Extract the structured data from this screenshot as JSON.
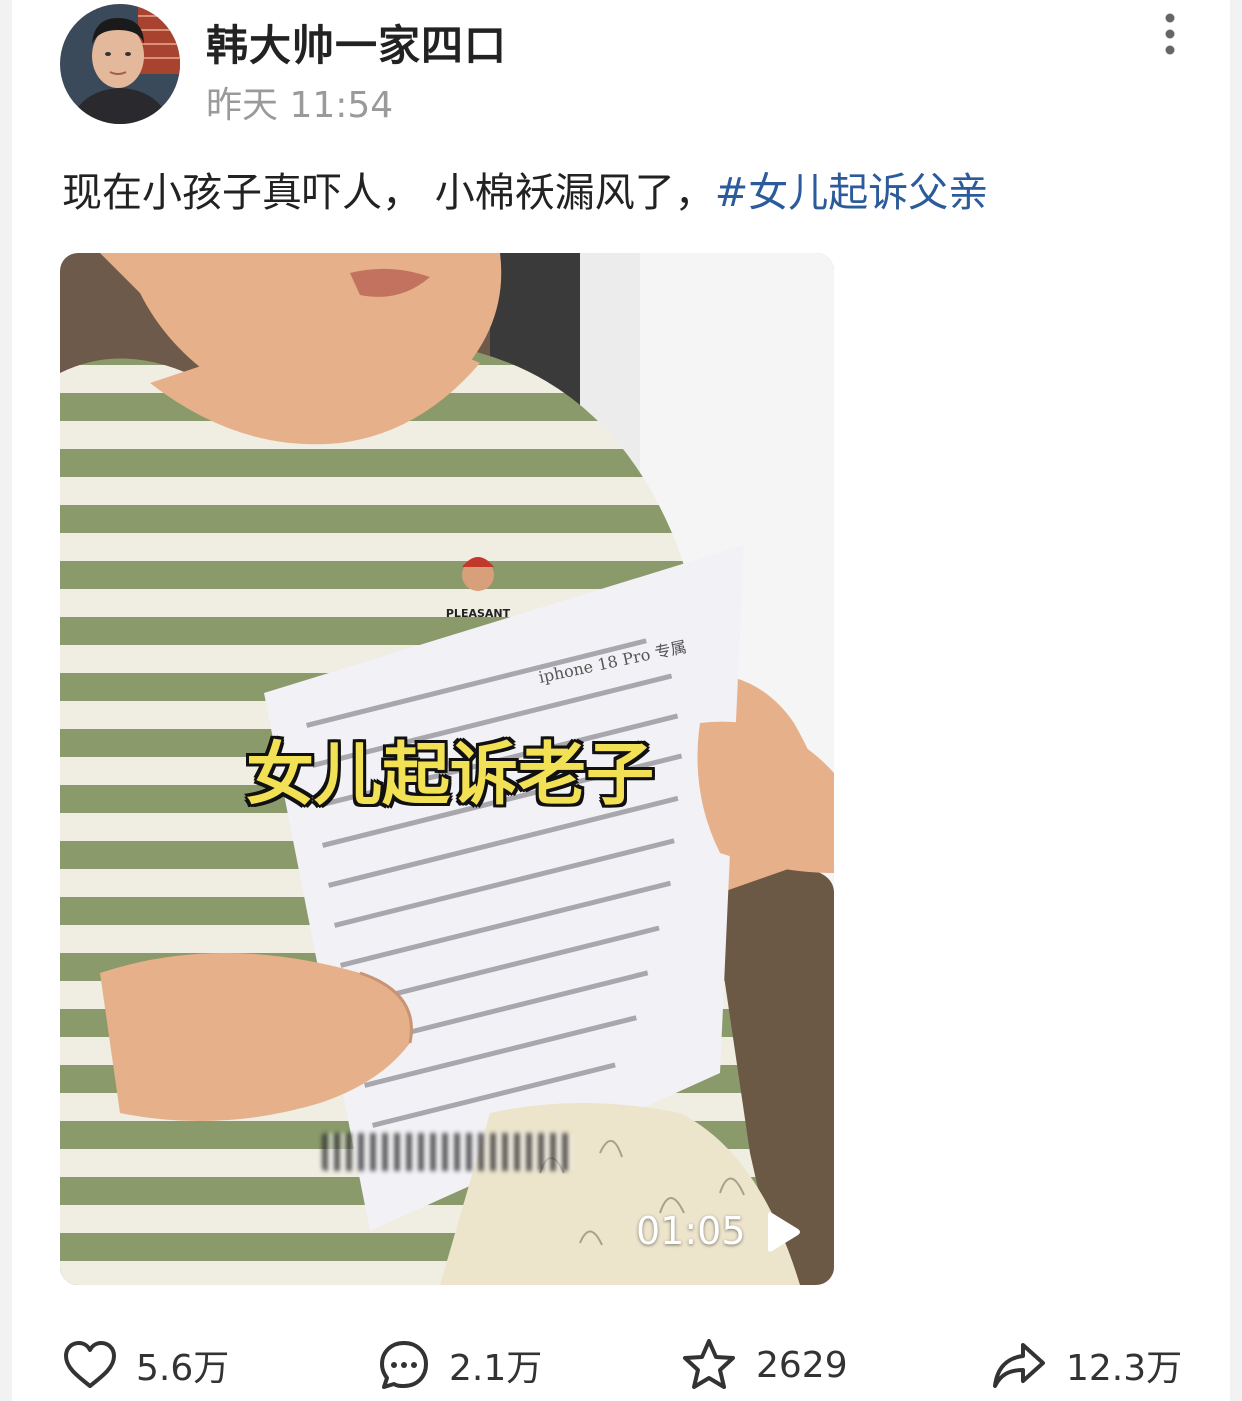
{
  "post": {
    "author": "韩大帅一家四口",
    "time": "昨天 11:54",
    "text": "现在小孩子真吓人， 小棉袄漏风了，",
    "hashtag": "#女儿起诉父亲"
  },
  "video": {
    "caption": "女儿起诉老子",
    "duration": "01:05",
    "paper_title": "iphone 18 Pro 专属",
    "shirt_logo": "PLEASANT"
  },
  "actions": {
    "likes": "5.6万",
    "comments": "2.1万",
    "favorites": "2629",
    "shares": "12.3万"
  },
  "colors": {
    "hashtag": "#2b5b9a",
    "caption": "#f2e055",
    "stripe": "#8a9a6a"
  }
}
